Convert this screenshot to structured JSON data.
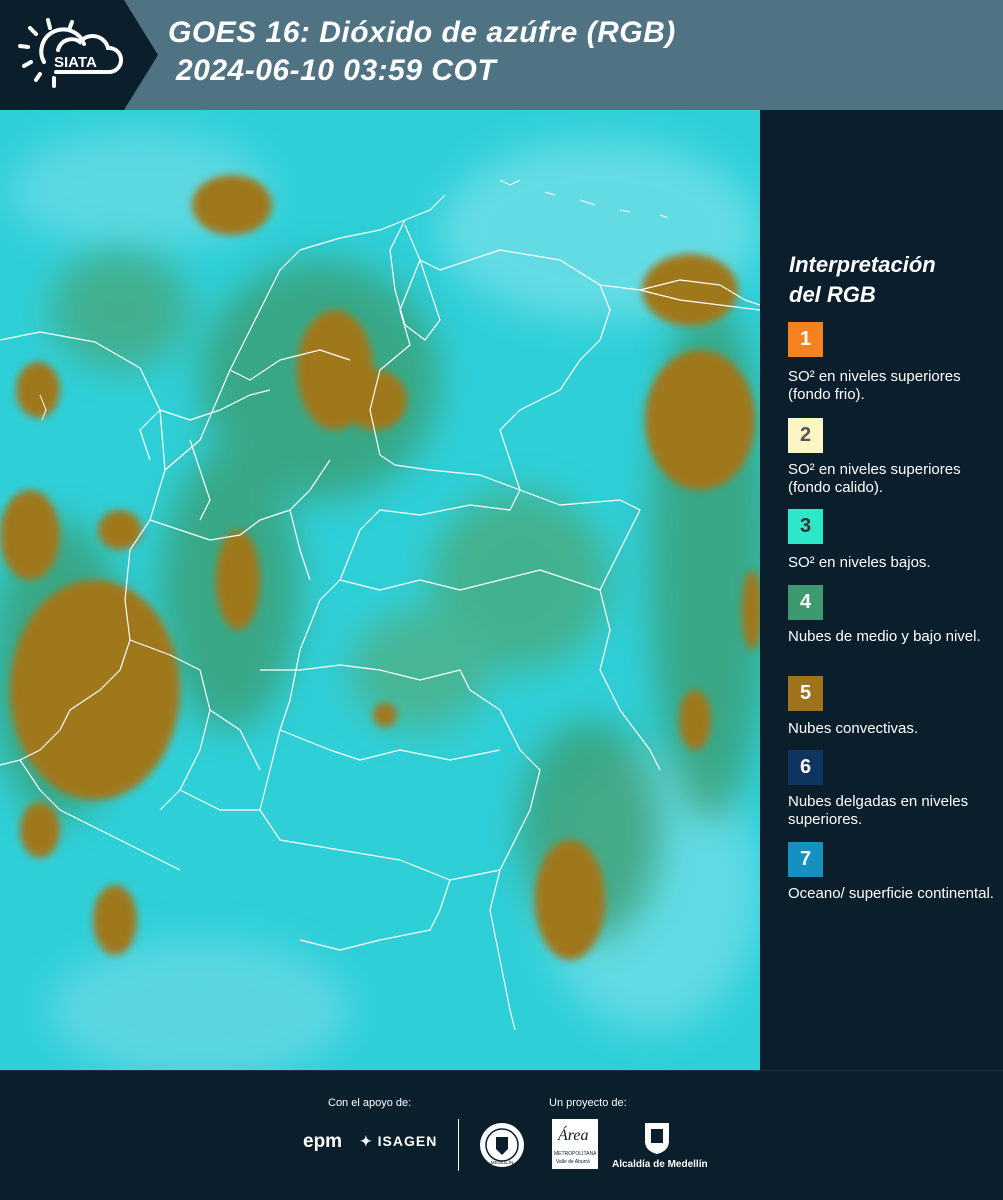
{
  "header": {
    "title_line1": "GOES 16: Dióxido de azúfre (RGB)",
    "title_line2": "2024-06-10 03:59 COT",
    "logo_text": "SIATA",
    "logo_icon": "sun-cloud-icon"
  },
  "map": {
    "background_color": "#2fcfd8",
    "border_color": "#ffffff",
    "cloud_color": "#a0781e",
    "low_cloud_color": "#3a9a6a"
  },
  "legend": {
    "title_line1": "Interpretación",
    "title_line2": "del RGB",
    "items": [
      {
        "number": "1",
        "color": "#f58220",
        "num_color": "#ffffff",
        "text": "SO² en niveles superiores (fondo frio)."
      },
      {
        "number": "2",
        "color": "#fdf5c4",
        "num_color": "#555555",
        "text": "SO² en niveles superiores (fondo calido)."
      },
      {
        "number": "3",
        "color": "#2de8c8",
        "num_color": "#333333",
        "text": "SO² en niveles bajos."
      },
      {
        "number": "4",
        "color": "#3c9a6e",
        "num_color": "#ffffff",
        "text": "Nubes de medio y bajo nivel."
      },
      {
        "number": "5",
        "color": "#a0721c",
        "num_color": "#ffffff",
        "text": "Nubes convectivas."
      },
      {
        "number": "6",
        "color": "#0e3460",
        "num_color": "#ffffff",
        "text": "Nubes delgadas en niveles superiores."
      },
      {
        "number": "7",
        "color": "#1590c0",
        "num_color": "#ffffff",
        "text": "Oceano/ superficie continental."
      }
    ]
  },
  "footer": {
    "support_label": "Con el apoyo de:",
    "project_label": "Un proyecto de:",
    "logo_epm": "epm",
    "logo_isagen": "ISAGEN",
    "logo_area_name": "Área",
    "logo_area_sub1": "METROPOLITANA",
    "logo_area_sub2": "Valle de Aburrá",
    "logo_alcaldia": "Alcaldía de Medellín",
    "logo_medellin_seal": "MEDELLÍN"
  }
}
